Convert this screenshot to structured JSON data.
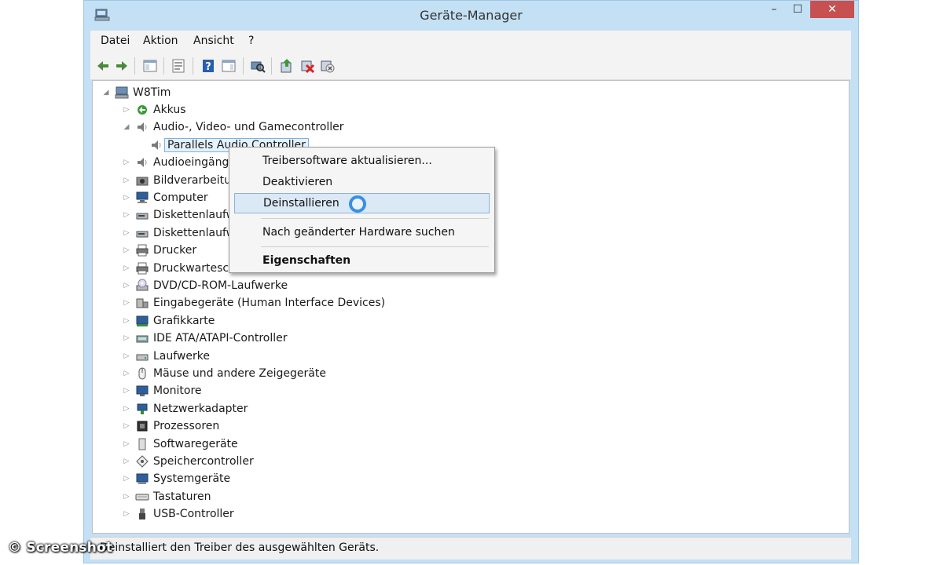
{
  "window": {
    "title": "Geräte-Manager",
    "close_label": "✕",
    "min_label": "–",
    "max_label": "☐"
  },
  "menu": [
    "Datei",
    "Aktion",
    "Ansicht",
    "?"
  ],
  "toolbar": {
    "icons": [
      "back-icon",
      "forward-icon",
      "show-hide-tree-icon",
      "properties-icon",
      "help-icon",
      "action-pane-icon",
      "scan-hardware-icon",
      "update-driver-icon",
      "disable-device-icon",
      "uninstall-device-icon"
    ]
  },
  "tree": {
    "root": "W8Tim",
    "categories": [
      {
        "label": "Akkus",
        "icon": "battery-icon"
      },
      {
        "label": "Audio-, Video- und Gamecontroller",
        "icon": "speaker-icon",
        "expanded": true
      },
      {
        "label": "Parallels Audio Controller",
        "icon": "speaker-icon",
        "child": true,
        "selected": true
      },
      {
        "label": "Audioeingäng",
        "icon": "speaker-icon"
      },
      {
        "label": "Bildverarbeitu",
        "icon": "camera-icon"
      },
      {
        "label": "Computer",
        "icon": "computer-icon"
      },
      {
        "label": "Diskettenlaufw",
        "icon": "floppy-drive-icon"
      },
      {
        "label": "Diskettenlaufw",
        "icon": "floppy-drive-icon"
      },
      {
        "label": "Drucker",
        "icon": "printer-icon"
      },
      {
        "label": "Druckwartesch",
        "icon": "printer-icon"
      },
      {
        "label": "DVD/CD-ROM-Laufwerke",
        "icon": "dvd-drive-icon"
      },
      {
        "label": "Eingabegeräte (Human Interface Devices)",
        "icon": "hid-icon"
      },
      {
        "label": "Grafikkarte",
        "icon": "display-adapter-icon"
      },
      {
        "label": "IDE ATA/ATAPI-Controller",
        "icon": "ide-controller-icon"
      },
      {
        "label": "Laufwerke",
        "icon": "disk-drive-icon"
      },
      {
        "label": "Mäuse und andere Zeigegeräte",
        "icon": "mouse-icon"
      },
      {
        "label": "Monitore",
        "icon": "monitor-icon"
      },
      {
        "label": "Netzwerkadapter",
        "icon": "network-adapter-icon"
      },
      {
        "label": "Prozessoren",
        "icon": "processor-icon"
      },
      {
        "label": "Softwaregeräte",
        "icon": "software-device-icon"
      },
      {
        "label": "Speichercontroller",
        "icon": "storage-controller-icon"
      },
      {
        "label": "Systemgeräte",
        "icon": "system-device-icon"
      },
      {
        "label": "Tastaturen",
        "icon": "keyboard-icon"
      },
      {
        "label": "USB-Controller",
        "icon": "usb-icon"
      }
    ]
  },
  "context_menu": {
    "items": [
      "Treibersoftware aktualisieren...",
      "Deaktivieren",
      "Deinstallieren",
      "Nach geänderter Hardware suchen",
      "Eigenschaften"
    ],
    "highlighted": "Deinstallieren",
    "bold": "Eigenschaften"
  },
  "statusbar": {
    "text": "Deinstalliert den Treiber des ausgewählten Geräts."
  },
  "watermark": "© Screenshot",
  "colors": {
    "frame": "#c4e0f4",
    "close": "#c75050",
    "highlight": "#dbe8f6",
    "busy": "#3b8fe0"
  }
}
